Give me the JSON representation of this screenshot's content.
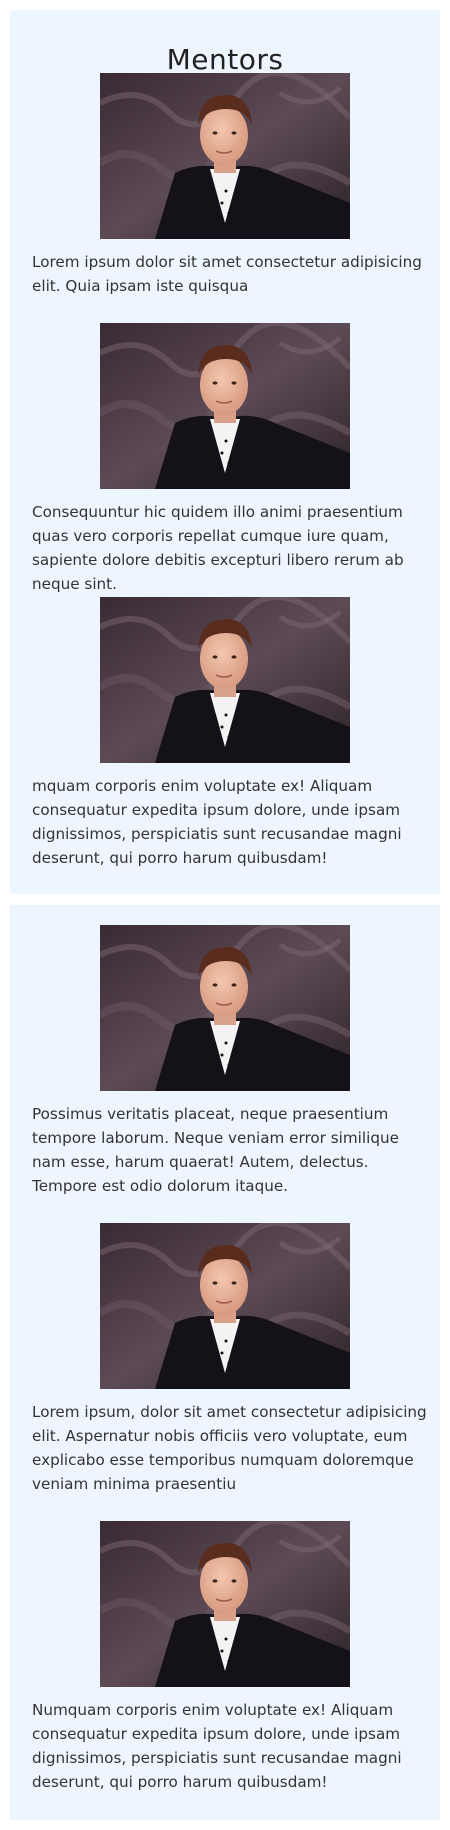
{
  "page": {
    "title": "Mentors"
  },
  "mentors": [
    {
      "photo": "mentor-portrait-photo",
      "description": "Lorem ipsum dolor sit amet consectetur adipisicing elit. Quia ipsam iste quisqua"
    },
    {
      "photo": "mentor-portrait-photo",
      "description": "Consequuntur hic quidem illo animi praesentium quas vero corporis repellat cumque iure quam, sapiente dolore debitis excepturi libero rerum ab neque sint."
    },
    {
      "photo": "mentor-portrait-photo",
      "description": "mquam corporis enim voluptate ex! Aliquam consequatur expedita ipsum dolore, unde ipsam dignissimos, perspiciatis sunt recusandae magni deserunt, qui porro harum quibusdam!"
    },
    {
      "photo": "mentor-portrait-photo",
      "description": "Possimus veritatis placeat, neque praesentium tempore laborum. Neque veniam error similique nam esse, harum quaerat! Autem, delectus. Tempore est odio dolorum itaque."
    },
    {
      "photo": "mentor-portrait-photo",
      "description": "Lorem ipsum, dolor sit amet consectetur adipisicing elit. Aspernatur nobis officiis vero voluptate, eum explicabo esse temporibus numquam doloremque veniam minima praesentiu"
    },
    {
      "photo": "mentor-portrait-photo",
      "description": "Numquam corporis enim voluptate ex! Aliquam consequatur expedita ipsum dolore, unde ipsam dignissimos, perspiciatis sunt recusandae magni deserunt, qui porro harum quibusdam!"
    }
  ],
  "colors": {
    "card_background": "#edf6ff",
    "text": "#333333",
    "title": "#222222"
  }
}
